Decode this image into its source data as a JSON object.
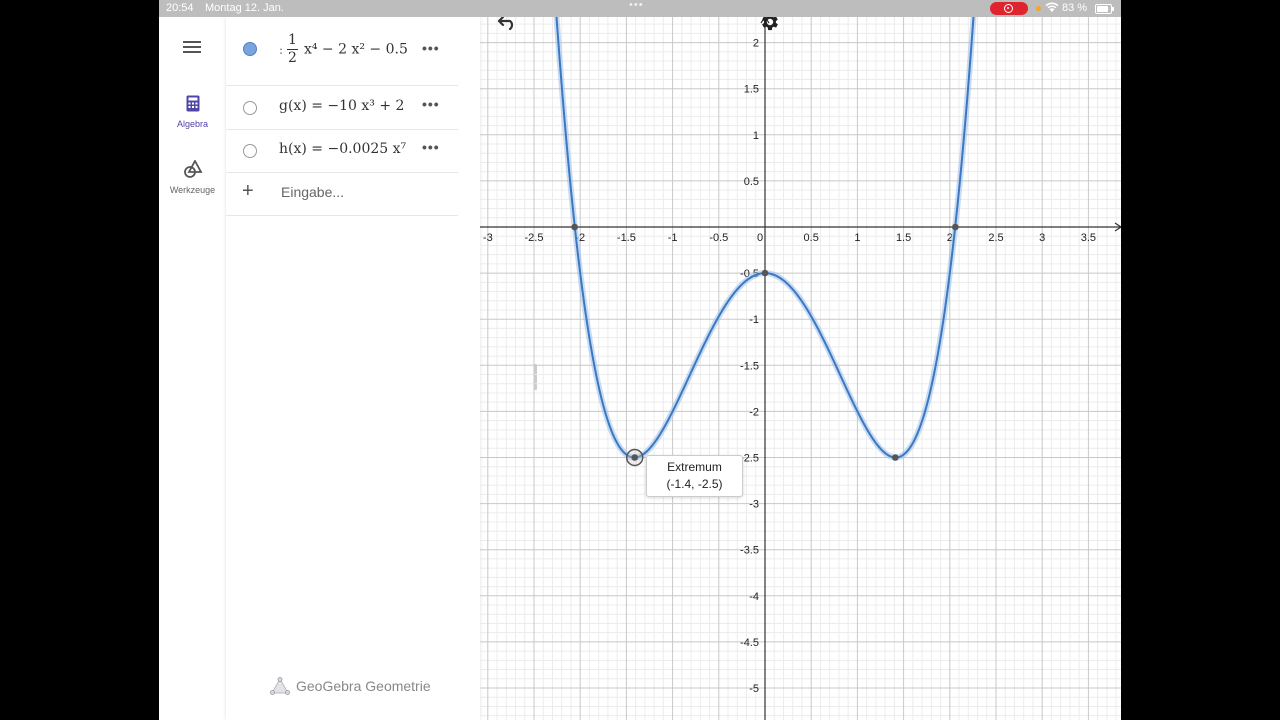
{
  "status_bar": {
    "time": "20:54",
    "date": "Montag 12. Jan.",
    "battery": "83 %"
  },
  "nav": {
    "algebra_label": "Algebra",
    "tools_label": "Werkzeuge"
  },
  "algebra_view": {
    "items": [
      {
        "prefix": ":",
        "frac_num": "1",
        "frac_den": "2",
        "expression": "x⁴ − 2 x² − 0.5",
        "visible": true
      },
      {
        "expression": "g(x)  =  −10 x³ + 2",
        "visible": false
      },
      {
        "expression": "h(x)  =  −0.0025 x⁷",
        "visible": false
      }
    ],
    "more_label": "•••",
    "input_placeholder": "Eingabe...",
    "app_name": "GeoGebra Geometrie"
  },
  "graphics": {
    "x_ticks": [
      "-3",
      "-2.5",
      "-2",
      "-1.5",
      "-1",
      "-0.5",
      "0",
      "0.5",
      "1",
      "1.5",
      "2",
      "2.5",
      "3",
      "3.5"
    ],
    "y_ticks": [
      "2",
      "1.5",
      "1",
      "0.5",
      "-0.5",
      "-1",
      "-1.5",
      "-2",
      "-2.5",
      "-3",
      "-3.5",
      "-4",
      "-4.5",
      "-5"
    ],
    "curve_color": "#3a78c2",
    "x_range": [
      -3.1,
      3.9
    ],
    "y_range": [
      -5.3,
      2.5
    ],
    "points": [
      {
        "x": -2.06,
        "y": 0
      },
      {
        "x": 0,
        "y": -0.5
      },
      {
        "x": 1.41,
        "y": -2.5
      },
      {
        "x": 2.06,
        "y": 0
      }
    ],
    "selected_point": {
      "x": -1.41,
      "y": -2.5
    },
    "tooltip_title": "Extremum",
    "tooltip_value": "(-1.4, -2.5)"
  }
}
